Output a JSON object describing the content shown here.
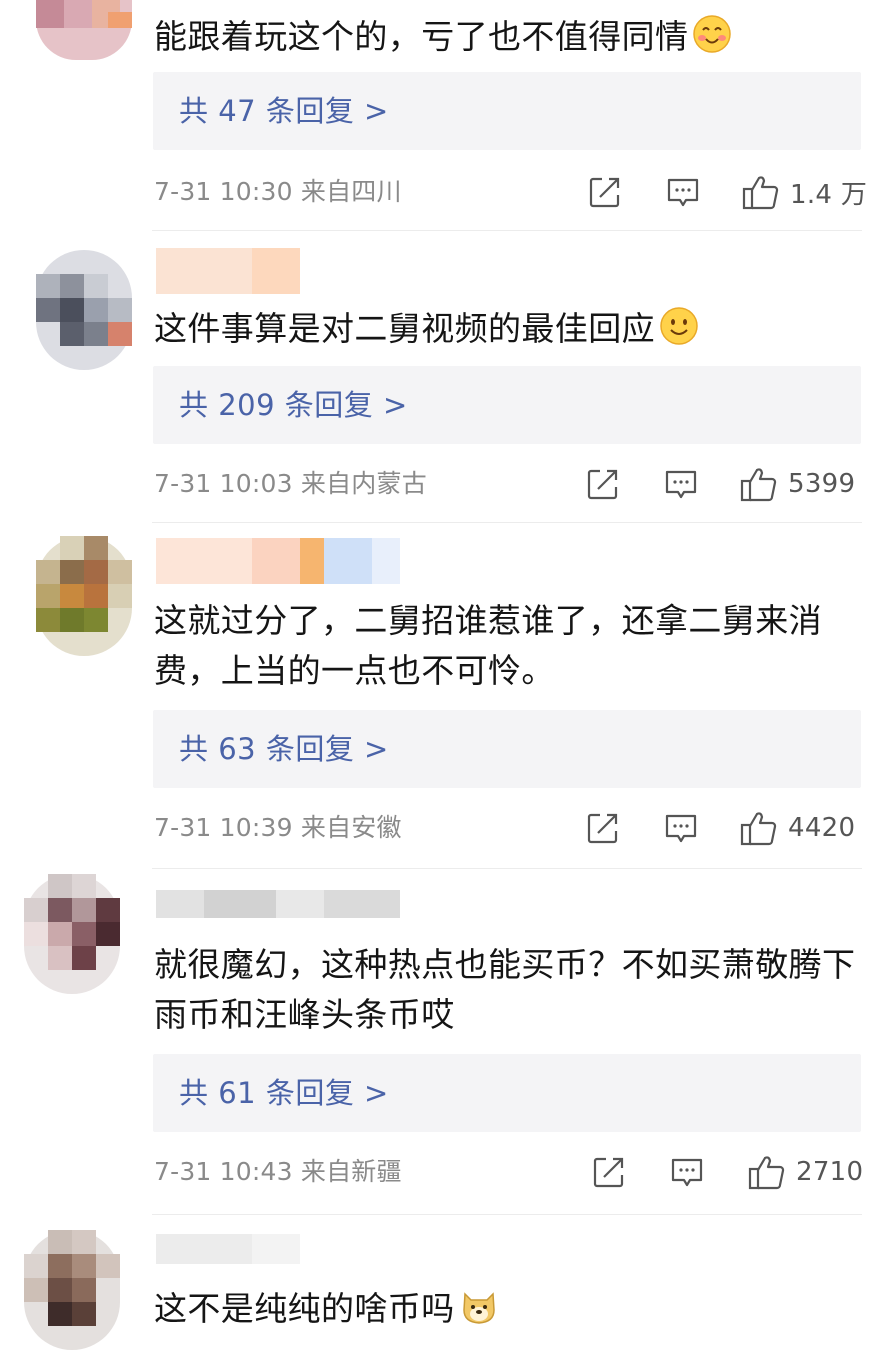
{
  "comments": [
    {
      "text": "能跟着玩这个的，亏了也不值得同情",
      "emoji": "blush-emoji-icon",
      "replies": "共 47 条回复 >",
      "time": "7-31 10:30",
      "location": "来自四川",
      "likes": "1.4 万"
    },
    {
      "text": "这件事算是对二舅视频的最佳回应",
      "emoji": "smile-emoji-icon",
      "replies": "共 209 条回复 >",
      "time": "7-31 10:03",
      "location": "来自内蒙古",
      "likes": "5399"
    },
    {
      "text": "这就过分了，二舅招谁惹谁了，还拿二舅来消费，上当的一点也不可怜。",
      "emoji": "",
      "replies": "共 63 条回复 >",
      "time": "7-31 10:39",
      "location": "来自安徽",
      "likes": "4420"
    },
    {
      "text": "就很魔幻，这种热点也能买币？不如买萧敬腾下雨币和汪峰头条币哎",
      "emoji": "",
      "replies": "共 61 条回复 >",
      "time": "7-31 10:43",
      "location": "来自新疆",
      "likes": "2710"
    },
    {
      "text": "这不是纯纯的啥币吗",
      "emoji": "doge-emoji-icon",
      "replies": "",
      "time": "",
      "location": "",
      "likes": ""
    }
  ],
  "icons": {
    "share": "share-icon",
    "comment": "comment-icon",
    "like": "thumbs-up-icon"
  },
  "colors": {
    "reply_link": "#4a63a8",
    "meta_gray": "#8a8a8a",
    "reply_bg": "#f4f4f6"
  }
}
